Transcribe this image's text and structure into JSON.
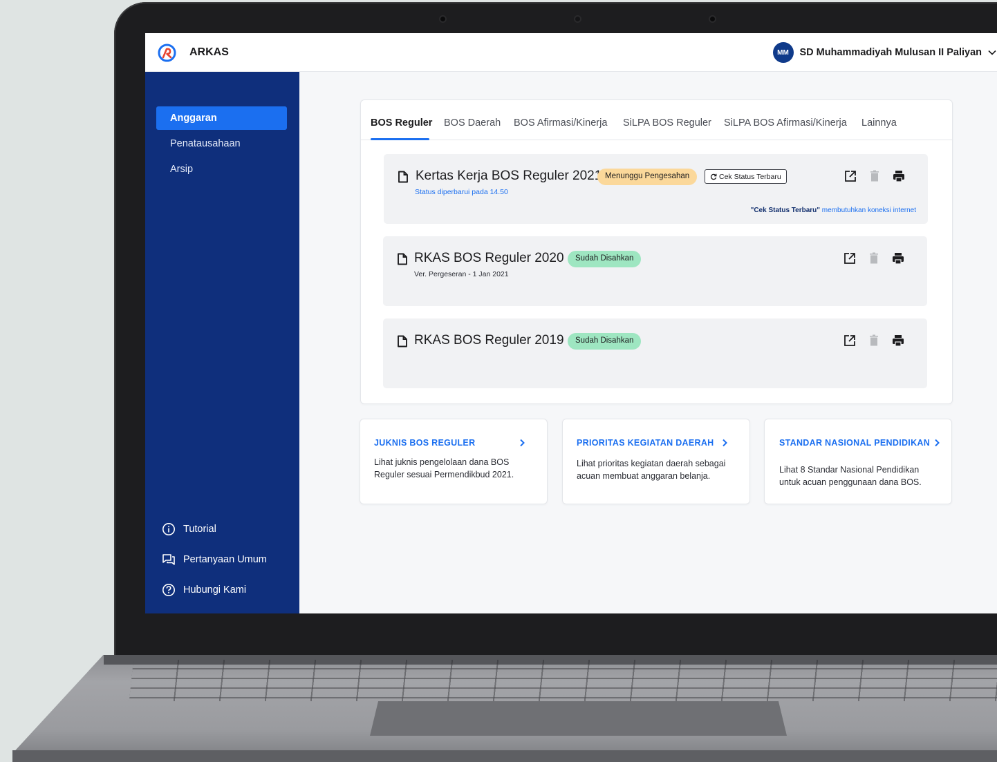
{
  "app": {
    "title": "ARKAS"
  },
  "user": {
    "initials": "MM",
    "school": "SD Muhammadiyah Mulusan II Paliyan"
  },
  "sidebar": {
    "items": [
      {
        "label": "Anggaran",
        "active": true
      },
      {
        "label": "Penatausahaan",
        "active": false
      },
      {
        "label": "Arsip",
        "active": false
      }
    ],
    "help": [
      {
        "label": "Tutorial",
        "icon": "info-icon"
      },
      {
        "label": "Pertanyaan Umum",
        "icon": "chat-icon"
      },
      {
        "label": "Hubungi Kami",
        "icon": "question-icon"
      }
    ]
  },
  "tabs": [
    {
      "label": "BOS Reguler",
      "active": true
    },
    {
      "label": "BOS Daerah"
    },
    {
      "label": "BOS Afirmasi/Kinerja"
    },
    {
      "label": "SiLPA BOS Reguler"
    },
    {
      "label": "SiLPA BOS Afirmasi/Kinerja"
    },
    {
      "label": "Lainnya"
    }
  ],
  "documents": [
    {
      "title": "Kertas Kerja BOS Reguler 2021",
      "status": "Menunggu Pengesahan",
      "status_type": "pending",
      "check_button": "Cek Status Terbaru",
      "subtext": "Status diperbarui pada 14.50",
      "note_bold": "\"Cek Status Terbaru\"",
      "note_rest": " membutuhkan koneksi internet"
    },
    {
      "title": "RKAS BOS Reguler 2020",
      "status": "Sudah Disahkan",
      "status_type": "ok",
      "subtext": "Ver. Pergeseran - 1 Jan 2021"
    },
    {
      "title": "RKAS BOS Reguler 2019",
      "status": "Sudah Disahkan",
      "status_type": "ok"
    }
  ],
  "info_cards": [
    {
      "title": "JUKNIS BOS REGULER",
      "desc": "Lihat juknis pengelolaan dana BOS Reguler sesuai Permendikbud 2021."
    },
    {
      "title": "PRIORITAS KEGIATAN DAERAH",
      "desc": "Lihat prioritas kegiatan daerah sebagai acuan membuat anggaran belanja."
    },
    {
      "title": "STANDAR NASIONAL PENDIDIKAN",
      "desc": "Lihat 8 Standar Nasional Pendidikan untuk acuan penggunaan dana BOS."
    }
  ],
  "colors": {
    "sidebar": "#0f2f7c",
    "accent": "#1b6ff0",
    "badge_pending": "#fbd89a",
    "badge_ok": "#9ee6c1"
  }
}
